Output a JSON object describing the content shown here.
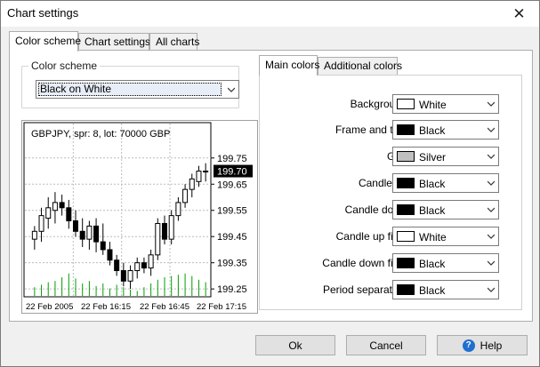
{
  "window": {
    "title": "Chart settings",
    "close_glyph": "✕"
  },
  "tabs": [
    {
      "label": "Color scheme",
      "active": true
    },
    {
      "label": "Chart settings",
      "active": false
    },
    {
      "label": "All charts",
      "active": false
    }
  ],
  "scheme": {
    "group_label": "Color scheme",
    "selected": "Black on White"
  },
  "color_tabs": [
    {
      "label": "Main colors",
      "active": true
    },
    {
      "label": "Additional colors",
      "active": false
    }
  ],
  "colors": [
    {
      "label": "Background:",
      "name": "White",
      "hex": "#ffffff"
    },
    {
      "label": "Frame and text:",
      "name": "Black",
      "hex": "#000000"
    },
    {
      "label": "Grid:",
      "name": "Silver",
      "hex": "#c0c0c0"
    },
    {
      "label": "Candle up:",
      "name": "Black",
      "hex": "#000000"
    },
    {
      "label": "Candle down:",
      "name": "Black",
      "hex": "#000000"
    },
    {
      "label": "Candle up filler:",
      "name": "White",
      "hex": "#ffffff"
    },
    {
      "label": "Candle down filler:",
      "name": "Black",
      "hex": "#000000"
    },
    {
      "label": "Period separators:",
      "name": "Black",
      "hex": "#000000"
    }
  ],
  "buttons": {
    "ok": "Ok",
    "cancel": "Cancel",
    "help": "Help"
  },
  "chart_data": {
    "type": "candlestick",
    "title": "GBPJPY, spr: 8, lot: 70000 GBP",
    "ylim": [
      199.22,
      199.79
    ],
    "y_ticks": [
      "199.75",
      "199.65",
      "199.55",
      "199.45",
      "199.35",
      "199.25"
    ],
    "y_tick_values": [
      199.75,
      199.65,
      199.55,
      199.45,
      199.35,
      199.25
    ],
    "current_price": "199.70",
    "current_price_value": 199.7,
    "x_ticks": [
      "22 Feb 2005",
      "22 Feb 16:15",
      "22 Feb 16:45",
      "22 Feb 17:15"
    ],
    "grid": true,
    "volume_color": "#00a000",
    "candles": [
      {
        "o": 199.44,
        "h": 199.49,
        "l": 199.4,
        "c": 199.47
      },
      {
        "o": 199.47,
        "h": 199.56,
        "l": 199.43,
        "c": 199.53
      },
      {
        "o": 199.52,
        "h": 199.6,
        "l": 199.48,
        "c": 199.56
      },
      {
        "o": 199.55,
        "h": 199.62,
        "l": 199.5,
        "c": 199.58
      },
      {
        "o": 199.58,
        "h": 199.61,
        "l": 199.53,
        "c": 199.56
      },
      {
        "o": 199.56,
        "h": 199.59,
        "l": 199.48,
        "c": 199.51
      },
      {
        "o": 199.51,
        "h": 199.55,
        "l": 199.45,
        "c": 199.47
      },
      {
        "o": 199.47,
        "h": 199.52,
        "l": 199.41,
        "c": 199.44
      },
      {
        "o": 199.44,
        "h": 199.51,
        "l": 199.4,
        "c": 199.49
      },
      {
        "o": 199.49,
        "h": 199.52,
        "l": 199.39,
        "c": 199.43
      },
      {
        "o": 199.43,
        "h": 199.5,
        "l": 199.38,
        "c": 199.4
      },
      {
        "o": 199.4,
        "h": 199.43,
        "l": 199.34,
        "c": 199.36
      },
      {
        "o": 199.36,
        "h": 199.38,
        "l": 199.3,
        "c": 199.32
      },
      {
        "o": 199.32,
        "h": 199.35,
        "l": 199.26,
        "c": 199.28
      },
      {
        "o": 199.28,
        "h": 199.34,
        "l": 199.25,
        "c": 199.32
      },
      {
        "o": 199.32,
        "h": 199.37,
        "l": 199.29,
        "c": 199.35
      },
      {
        "o": 199.35,
        "h": 199.37,
        "l": 199.31,
        "c": 199.33
      },
      {
        "o": 199.33,
        "h": 199.4,
        "l": 199.3,
        "c": 199.38
      },
      {
        "o": 199.38,
        "h": 199.52,
        "l": 199.36,
        "c": 199.5
      },
      {
        "o": 199.5,
        "h": 199.53,
        "l": 199.42,
        "c": 199.44
      },
      {
        "o": 199.44,
        "h": 199.55,
        "l": 199.42,
        "c": 199.53
      },
      {
        "o": 199.53,
        "h": 199.6,
        "l": 199.51,
        "c": 199.58
      },
      {
        "o": 199.58,
        "h": 199.65,
        "l": 199.56,
        "c": 199.63
      },
      {
        "o": 199.63,
        "h": 199.69,
        "l": 199.6,
        "c": 199.67
      },
      {
        "o": 199.66,
        "h": 199.72,
        "l": 199.64,
        "c": 199.7
      },
      {
        "o": 199.7,
        "h": 199.73,
        "l": 199.66,
        "c": 199.7
      }
    ],
    "volumes": [
      0.35,
      0.45,
      0.55,
      0.6,
      0.75,
      0.9,
      0.7,
      0.5,
      0.6,
      0.4,
      0.5,
      0.3,
      0.45,
      0.35,
      0.25,
      0.2,
      0.35,
      0.5,
      0.65,
      0.75,
      0.8,
      0.85,
      0.9,
      0.8,
      0.65,
      0.55
    ]
  }
}
